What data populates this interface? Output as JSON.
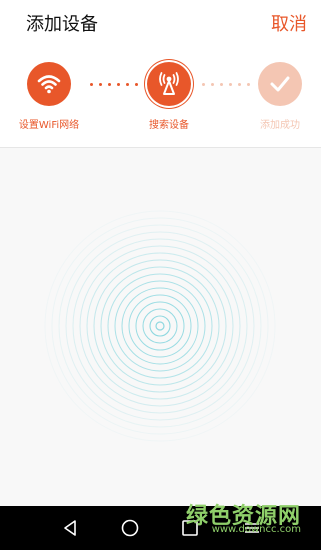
{
  "header": {
    "title": "添加设备",
    "cancel_label": "取消"
  },
  "steps": [
    {
      "label": "设置WiFi网络",
      "icon": "wifi-icon",
      "state": "done"
    },
    {
      "label": "搜索设备",
      "icon": "antenna-icon",
      "state": "active"
    },
    {
      "label": "添加成功",
      "icon": "check-icon",
      "state": "pending"
    }
  ],
  "colors": {
    "accent": "#e8572a",
    "pending": "#f4c6b3",
    "radar": "#8fd8e0",
    "dots_done": "#e8572a",
    "dots_pending": "#f4c6b3"
  },
  "search": {
    "status": "searching"
  },
  "watermark": {
    "text": "绿色资源网",
    "url": "www.downcc.com"
  }
}
